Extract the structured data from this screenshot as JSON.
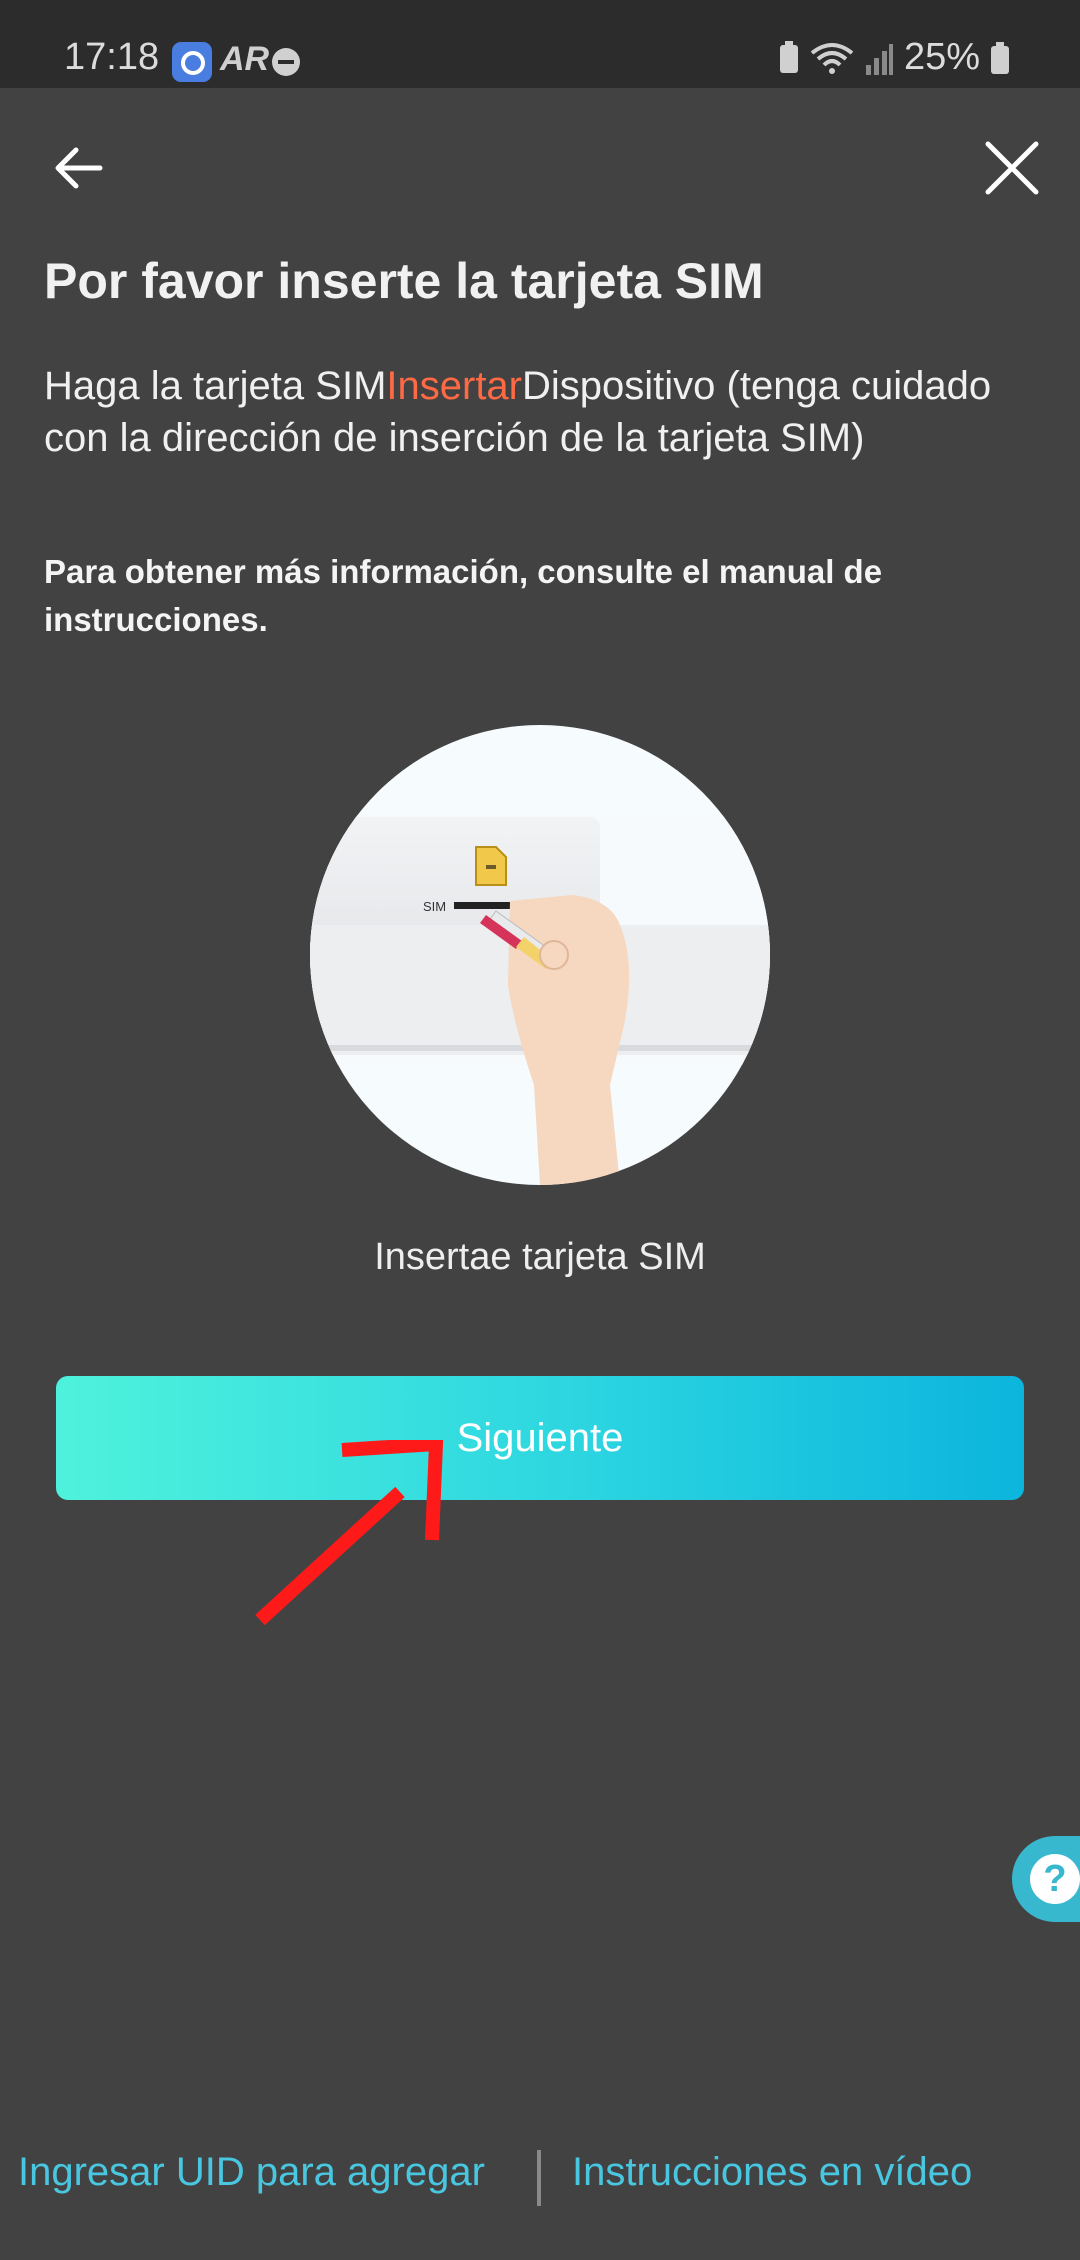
{
  "status_bar": {
    "time": "17:18",
    "app_badge": "AR",
    "battery": "25%"
  },
  "header": {
    "back_icon": "arrow-left-icon",
    "close_icon": "close-icon"
  },
  "content": {
    "title": "Por favor inserte la tarjeta SIM",
    "description_prefix": "Haga la tarjeta SIM",
    "description_highlight": "Insertar",
    "description_suffix": "Dispositivo (tenga cuidado con la dirección de inserción de la tarjeta SIM)",
    "note": "Para obtener más información, consulte el manual de instrucciones.",
    "illustration_label": "SIM",
    "illustration_caption": "Insertae tarjeta SIM",
    "highlight_color": "#ff6a45"
  },
  "actions": {
    "next_label": "Siguiente"
  },
  "help": {
    "icon_glyph": "?"
  },
  "footer": {
    "uid_link": "Ingresar UID para agregar",
    "video_link": "Instrucciones en vídeo"
  }
}
